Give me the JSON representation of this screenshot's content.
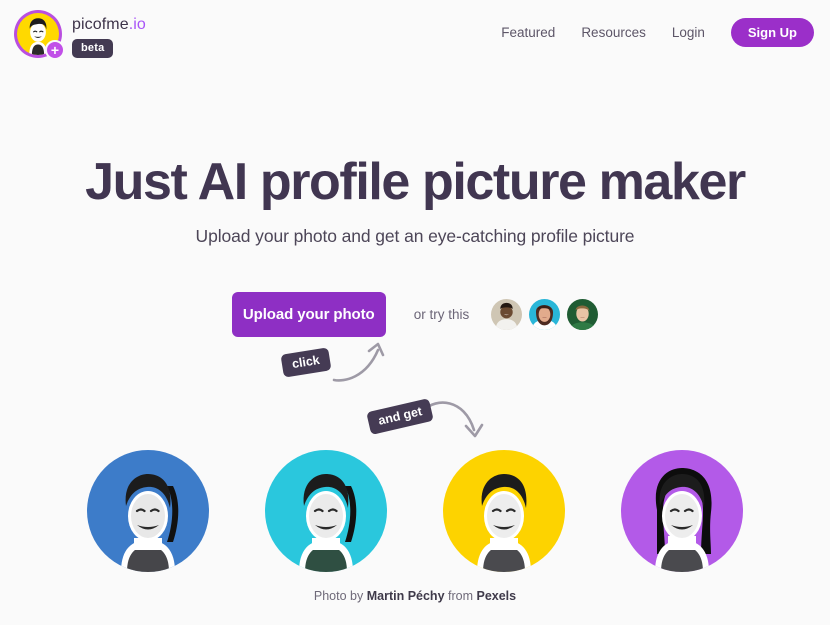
{
  "header": {
    "brand_name": "picofme",
    "brand_tld": ".io",
    "beta_label": "beta",
    "logo_icon": "avatar-logo-icon",
    "plus_icon": "plus-icon",
    "nav_links": [
      {
        "label": "Featured"
      },
      {
        "label": "Resources"
      },
      {
        "label": "Login"
      }
    ],
    "signup_label": "Sign Up"
  },
  "hero": {
    "title": "Just AI profile picture maker",
    "subtitle": "Upload your photo and get an eye-catching profile picture"
  },
  "cta": {
    "upload_label": "Upload your photo",
    "try_label": "or try this",
    "samples": [
      {
        "name": "sample-avatar-1",
        "bg": "#cfc6b4"
      },
      {
        "name": "sample-avatar-2",
        "bg": "#29b6d8"
      },
      {
        "name": "sample-avatar-3",
        "bg": "#1f5c33"
      }
    ]
  },
  "annotations": {
    "click_label": "click",
    "and_get_label": "and get",
    "arrow_color": "#9e9aa6"
  },
  "results": [
    {
      "name": "result-avatar-blue",
      "bg": "#3d7cc9",
      "outline": "light"
    },
    {
      "name": "result-avatar-cyan",
      "bg": "#2ac7dd",
      "outline": "light"
    },
    {
      "name": "result-avatar-yellow",
      "bg": "#fdd300",
      "outline": "none"
    },
    {
      "name": "result-avatar-purple",
      "bg": "#b35ae8",
      "outline": "heavy"
    }
  ],
  "credit": {
    "prefix": "Photo by ",
    "author": "Martin Péchy",
    "middle": " from ",
    "source": "Pexels"
  },
  "colors": {
    "page_bg": "#fafafa",
    "brand_purple": "#a855f7",
    "cta_purple": "#8e2fc4",
    "signup_purple": "#9b2fc9",
    "dark_text": "#413651",
    "badge_dark": "#453b54"
  }
}
